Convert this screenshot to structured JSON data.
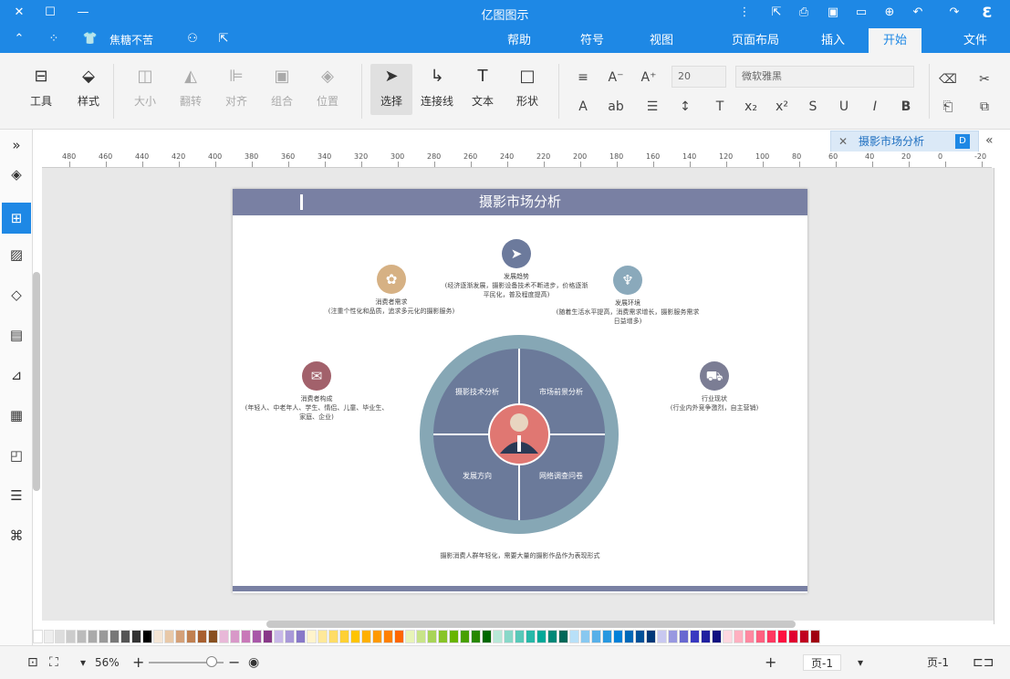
{
  "app": {
    "title": "亿图图示"
  },
  "tabs": [
    {
      "label": "文件"
    },
    {
      "label": "开始"
    },
    {
      "label": "插入"
    },
    {
      "label": "页面布局"
    },
    {
      "label": "视图"
    },
    {
      "label": "符号"
    },
    {
      "label": "帮助"
    }
  ],
  "user": {
    "name": "焦糖不苦"
  },
  "ribbon": {
    "cut": "剪切",
    "font_name": "微软雅黑",
    "font_size": "20",
    "shape": "形状",
    "text": "文本",
    "connector": "连接线",
    "select": "选择",
    "position": "位置",
    "group": "组合",
    "align": "对齐",
    "flip": "翻转",
    "size": "大小",
    "style": "样式",
    "tools": "工具"
  },
  "doc": {
    "tab": "摄影市场分析"
  },
  "page": {
    "title": "摄影市场分析",
    "nodes": [
      {
        "title": "发展趋势",
        "desc": "(经济逐渐发展，摄影设备技术不断进步，价格逐渐平民化，普及程度提高)",
        "icon": "➤",
        "color": "#6c7a9c"
      },
      {
        "title": "发展环境",
        "desc": "(随着生活水平提高，消费需求增长，摄影服务需求日益增多)",
        "icon": "♆",
        "color": "#8aa9bb"
      },
      {
        "title": "消费者需求",
        "desc": "(注重个性化和品质，追求多元化的摄影服务)",
        "icon": "✿",
        "color": "#d6b184"
      },
      {
        "title": "行业现状",
        "desc": "(行业内外竞争激烈，自主营销)",
        "icon": "⛟",
        "color": "#7b7d94"
      },
      {
        "title": "消费者构成",
        "desc": "(年轻人、中老年人、学生、情侣、儿童、毕业生、家庭、企业)",
        "icon": "✉",
        "color": "#a2616b"
      }
    ],
    "quadrants": {
      "tl": "摄影技术分析",
      "tr": "市场前景分析",
      "bl": "发展方向",
      "br": "网络调查问卷"
    },
    "note": "摄影消费人群年轻化，需要大量的摄影作品作为表现形式"
  },
  "status": {
    "page_label": "页-1",
    "page_tab": "页-1",
    "zoom": "56%"
  }
}
